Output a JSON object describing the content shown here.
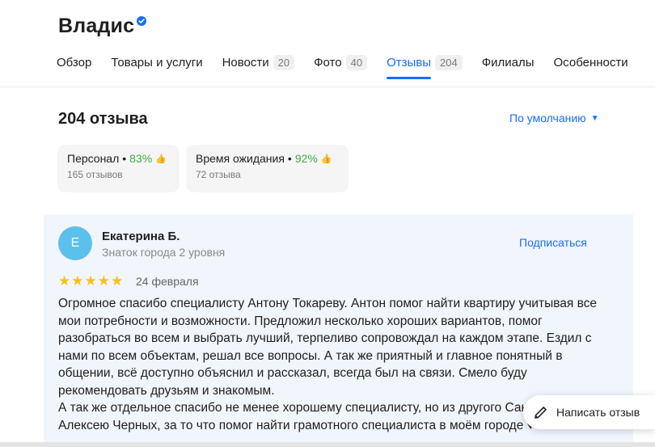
{
  "business": {
    "name": "Владис"
  },
  "tabs": [
    {
      "label": "Обзор",
      "count": ""
    },
    {
      "label": "Товары и услуги",
      "count": ""
    },
    {
      "label": "Новости",
      "count": "20"
    },
    {
      "label": "Фото",
      "count": "40"
    },
    {
      "label": "Отзывы",
      "count": "204"
    },
    {
      "label": "Филиалы",
      "count": ""
    },
    {
      "label": "Особенности",
      "count": ""
    }
  ],
  "reviews": {
    "total_label": "204 отзыва",
    "sort_label": "По умолчанию"
  },
  "aspects": [
    {
      "name": "Персонал",
      "percent": "83%",
      "count": "165 отзывов"
    },
    {
      "name": "Время ожидания",
      "percent": "92%",
      "count": "72 отзыва"
    }
  ],
  "review": {
    "avatar_letter": "Е",
    "author": "Екатерина Б.",
    "level": "Знаток города 2 уровня",
    "subscribe_label": "Подписаться",
    "rating": 5,
    "date": "24 февраля",
    "text": "Огромное спасибо специалисту Антону Токареву. Антон помог найти квартиру учитывая все мои потребности и возможности. Предложил несколько хороших вариантов, помог разобраться во всем и выбрать лучший, терпеливо сопровождал на каждом этапе. Ездил с нами по всем объектам, решал все вопросы. А так же приятный и главное понятный в общении, всё доступно объяснил и рассказал, всегда был на связи. Смело буду рекомендовать друзьям и знакомым.\nА так же отдельное спасибо не менее хорошему специалисту, но из другого Санкт-Петербург) Алексею Черных, за то что помог найти грамотного специалиста в моём городе ♥"
  },
  "write_review": {
    "label": "Написать отзыв"
  },
  "colors": {
    "accent": "#196dff",
    "positive": "#3cb043",
    "star": "#fcbf0f",
    "avatar": "#5bc0eb"
  }
}
